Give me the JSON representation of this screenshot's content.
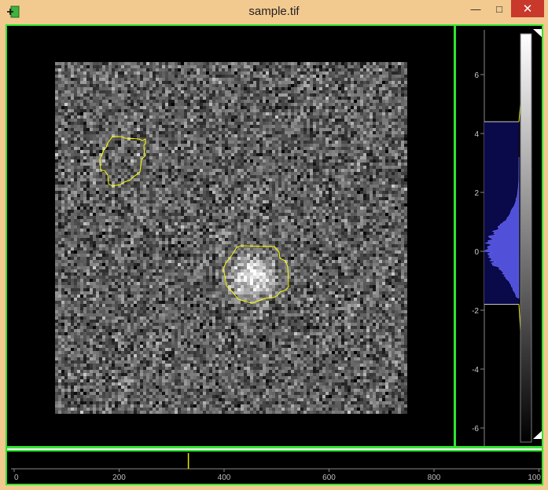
{
  "window": {
    "title": "sample.tif",
    "controls": {
      "minimize": "—",
      "maximize": "□",
      "close": "✕"
    }
  },
  "histogram": {
    "y_ticks": [
      "6",
      "4",
      "2",
      "0",
      "-2",
      "-4",
      "-6"
    ],
    "level_range": [
      -1.8,
      4.4
    ]
  },
  "timeline": {
    "ticks": [
      "0",
      "200",
      "400",
      "600",
      "800",
      "100"
    ],
    "current_frame": 332
  },
  "colors": {
    "frame_border": "#2fe52f",
    "roi": "#ffff00",
    "close_button": "#c8392b",
    "histogram_fill": "#5050d8",
    "histogram_region": "#0a0a4a"
  }
}
